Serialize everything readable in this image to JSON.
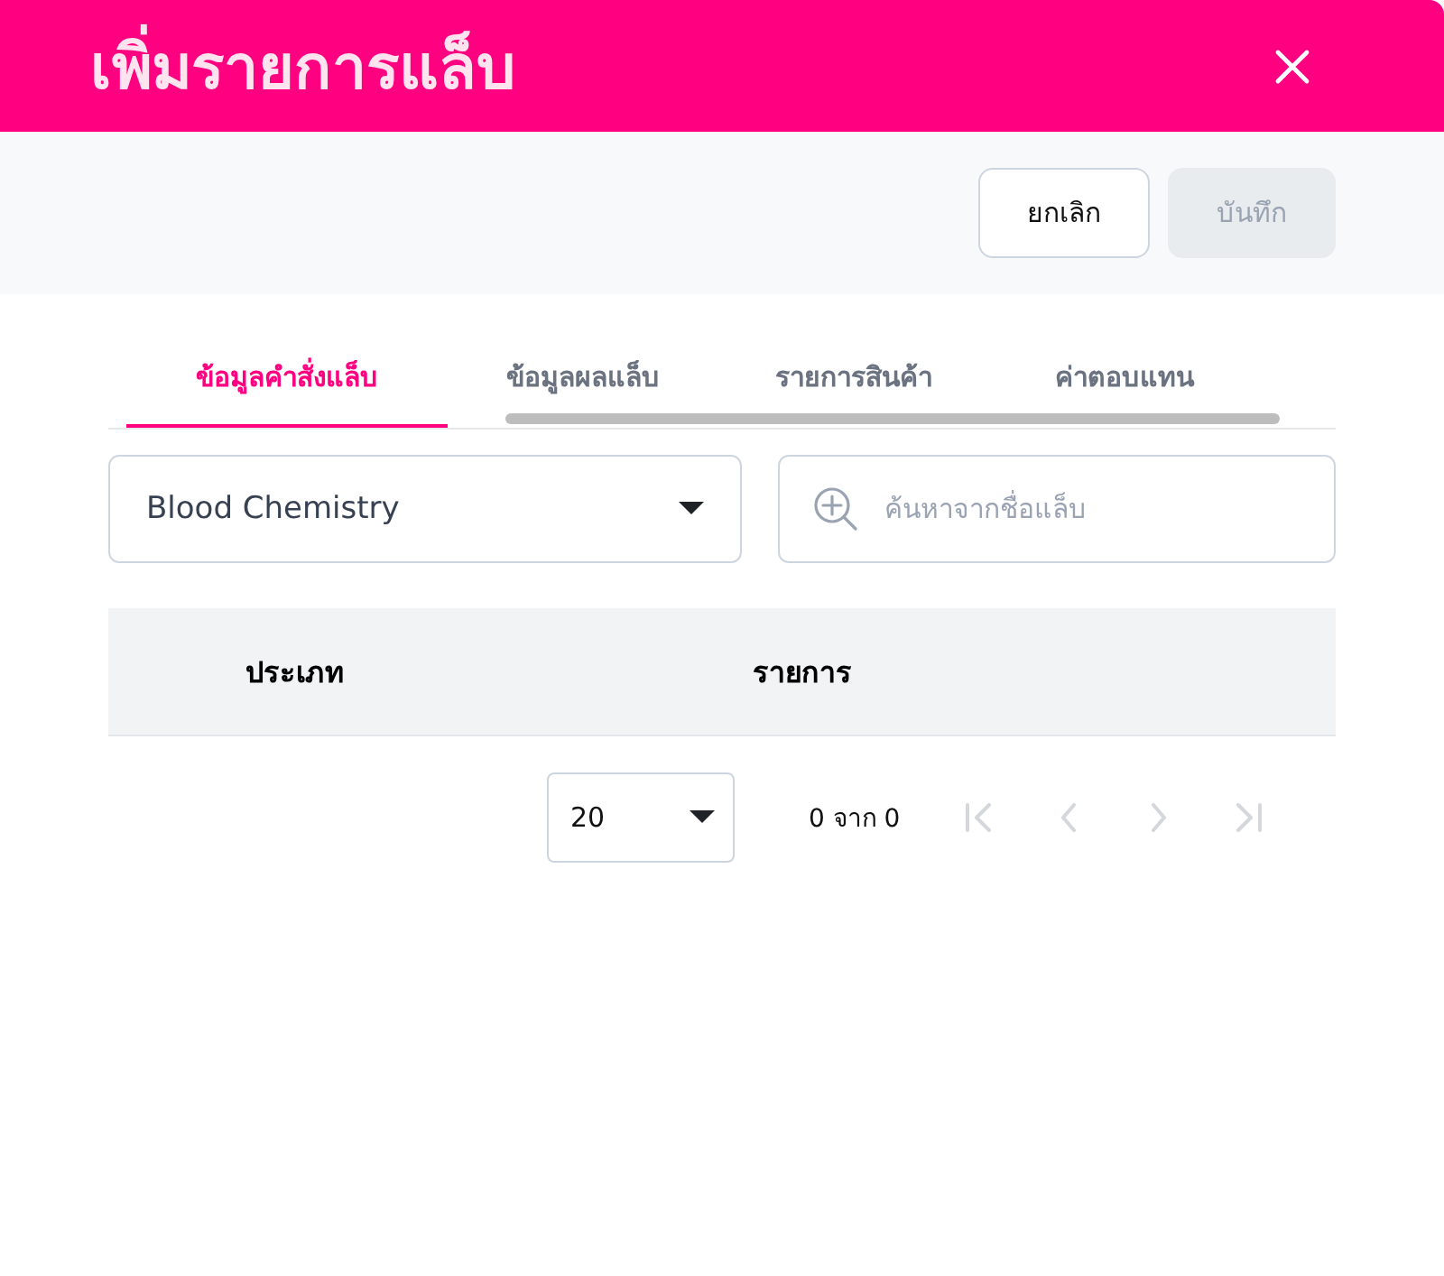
{
  "dialog": {
    "title": "เพิ่มรายการแล็บ"
  },
  "actions": [
    {
      "label": "ยกเลิก",
      "disabled": false
    },
    {
      "label": "บันทึก",
      "disabled": true
    }
  ],
  "tabs": [
    {
      "label": "ข้อมูลคำสั่งแล็บ",
      "selected": true
    },
    {
      "label": "ข้อมูลผลแล็บ",
      "selected": false
    },
    {
      "label": "รายการสินค้า",
      "selected": false
    },
    {
      "label": "ค่าตอบแทน",
      "selected": false
    }
  ],
  "filter": {
    "value": "Blood Chemistry"
  },
  "search": {
    "placeholder": "ค้นหาจากชื่อแล็บ"
  },
  "table": {
    "columns": [
      "ประเภท",
      "รายการ"
    ]
  },
  "pager": {
    "page_size": "20",
    "range": "0 จาก 0",
    "nav": [
      {
        "kind": "first",
        "disabled": true
      },
      {
        "kind": "prev",
        "disabled": true
      },
      {
        "kind": "next",
        "disabled": true
      },
      {
        "kind": "last",
        "disabled": true
      }
    ]
  }
}
